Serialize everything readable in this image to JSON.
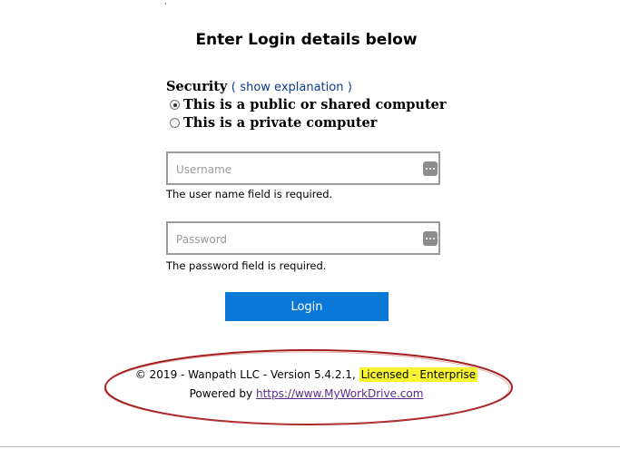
{
  "heading": "Enter Login details below",
  "security": {
    "label": "Security",
    "paren_open": "(",
    "link": "show explanation",
    "paren_close": ")",
    "options": [
      {
        "label": "This is a public or shared computer",
        "checked": true
      },
      {
        "label": "This is a private computer",
        "checked": false
      }
    ]
  },
  "username": {
    "placeholder": "Username",
    "value": "",
    "error": "The user name field is required.",
    "icon": "password-manager-icon"
  },
  "password": {
    "placeholder": "Password",
    "value": "",
    "error": "The password field is required.",
    "icon": "password-manager-icon"
  },
  "login_button": "Login",
  "footer": {
    "copyright": "© 2019 - Wanpath LLC - Version 5.4.2.1,",
    "license": "Licensed - Enterprise",
    "powered_by": "Powered by",
    "link": "https://www.MyWorkDrive.com"
  },
  "colors": {
    "button": "#0a78d7",
    "highlight": "#f7f530",
    "annotation": "#a51e1e"
  }
}
